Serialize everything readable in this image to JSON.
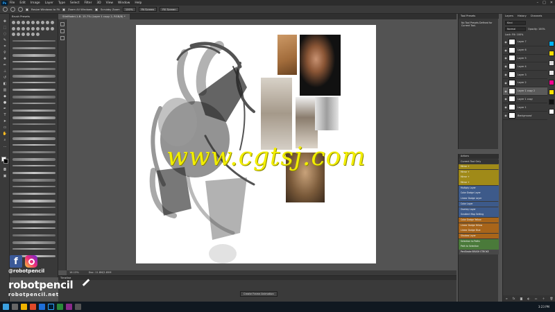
{
  "app": {
    "logo": "Ps"
  },
  "menu": [
    "File",
    "Edit",
    "Image",
    "Layer",
    "Type",
    "Select",
    "Filter",
    "3D",
    "View",
    "Window",
    "Help"
  ],
  "options": {
    "resize_windows": "Resize Windows to Fit",
    "zoom_all": "Zoom All Windows",
    "scrubby_zoom": "Scrubby Zoom",
    "zoom_100": "100%",
    "fit_screen": "Fit Screen",
    "fill_screen": "Fill Screen"
  },
  "brush_panel": {
    "title": "Brush Presets"
  },
  "document": {
    "tab": "SiteModel-1-B- 15.7% (Layer 1 copy 2, RGB/8) *",
    "status_zoom": "16.13%",
    "status_doc": "Doc: 11.8M/2.85M"
  },
  "watermark": "www.cgtsj.com",
  "timeline": {
    "title": "Timeline",
    "create_button": "Create Frame Animation"
  },
  "tool_presets": {
    "title": "Tool Presets",
    "message": "No Tool Presets Defined for Current Tool."
  },
  "actions": {
    "tabs": [
      "Actions"
    ],
    "set_title": "Current Tool Only",
    "items": [
      {
        "label": "Mirror +",
        "color": "#a08a18"
      },
      {
        "label": "Mirror +",
        "color": "#a08a18"
      },
      {
        "label": "Mirror +",
        "color": "#a08a18"
      },
      {
        "label": "Mirror +",
        "color": "#a08a18"
      },
      {
        "label": "Multiply Layer",
        "color": "#3d5a8a"
      },
      {
        "label": "Color Dodge Layer",
        "color": "#3d5a8a"
      },
      {
        "label": "Linear Dodge Layer",
        "color": "#3d5a8a"
      },
      {
        "label": "Color Layer",
        "color": "#3d5a8a"
      },
      {
        "label": "Overlay Layer",
        "color": "#3d5a8a"
      },
      {
        "label": "Gradient Map Setting",
        "color": "#3d5a8a"
      },
      {
        "label": "Color Dodge Yellow",
        "color": "#a8651a"
      },
      {
        "label": "Linear Dodge Yellow",
        "color": "#a8651a"
      },
      {
        "label": "Linear Dodge Blue",
        "color": "#a8651a"
      },
      {
        "label": "Shadow Layer",
        "color": "#a8651a"
      },
      {
        "label": "Selection to Paths",
        "color": "#4a7a3a"
      },
      {
        "label": "Path to Selection",
        "color": "#4a7a3a"
      },
      {
        "label": "PenStroke BRUSH STROKE",
        "color": "#484848"
      }
    ]
  },
  "layers": {
    "tabs": [
      "Layers",
      "History",
      "Channels"
    ],
    "kind": "Kind",
    "mode": "Normal",
    "opacity": "Opacity: 100%",
    "lock": "Lock:   Fill: 100%",
    "items": [
      {
        "name": "Layer 7",
        "selected": false
      },
      {
        "name": "Layer 6",
        "selected": false
      },
      {
        "name": "Layer 5",
        "selected": false
      },
      {
        "name": "Layer 4",
        "selected": false
      },
      {
        "name": "Layer 3",
        "selected": false
      },
      {
        "name": "Layer 2",
        "selected": false
      },
      {
        "name": "Layer 1 copy 2",
        "selected": true
      },
      {
        "name": "Layer 1 copy",
        "selected": false
      },
      {
        "name": "Layer 1",
        "selected": false
      },
      {
        "name": "Background",
        "selected": false
      }
    ],
    "swatches": [
      "#00b4ff",
      "#ffde00",
      "#dcdcdc",
      "#e8e8e8",
      "#ff0090",
      "#ffe100",
      "#111111",
      "#ffffff"
    ]
  },
  "brand": {
    "handle": "@robotpencil",
    "name": "robotpencil",
    "url": "robotpencil.net"
  },
  "taskbar": {
    "time": "3:23 PM"
  }
}
